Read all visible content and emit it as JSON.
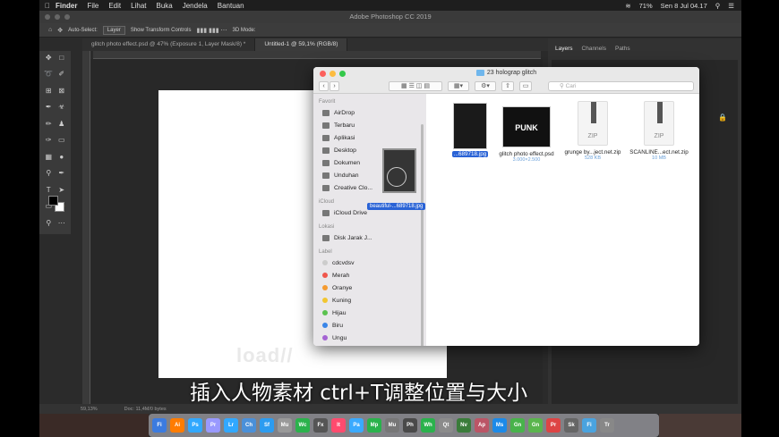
{
  "menubar": {
    "app": "Finder",
    "items": [
      "File",
      "Edit",
      "Lihat",
      "Buka",
      "Jendela",
      "Bantuan"
    ],
    "battery": "71%",
    "datetime": "Sen 8 Jul  04.17"
  },
  "photoshop": {
    "title": "Adobe Photoshop CC 2019",
    "options": {
      "auto_select": "Auto-Select:",
      "layer_select": "Layer",
      "transform": "Show Transform Controls",
      "mode3d": "3D Mode:"
    },
    "tabs": [
      "glitch photo effect.psd @ 47% (Exposure 1, Layer Mask/8) *",
      "Untitled-1 @ 59,1% (RGB/8)"
    ],
    "panel_tabs": [
      "Layers",
      "Channels",
      "Paths"
    ],
    "status_zoom": "59,13%",
    "status_doc": "Doc: 11,4M/0 bytes"
  },
  "finder": {
    "title": "23 holograp glitch",
    "search_placeholder": "Cari",
    "sidebar": {
      "favorites_label": "Favorit",
      "favorites": [
        "AirDrop",
        "Terbaru",
        "Aplikasi",
        "Desktop",
        "Dokumen",
        "Unduhan",
        "Creative Clo..."
      ],
      "icloud_label": "iCloud",
      "icloud": [
        "iCloud Drive"
      ],
      "locations_label": "Lokasi",
      "locations": [
        "Disk Jarak J..."
      ],
      "tags_label": "Label",
      "tags": [
        {
          "name": "cdcvdsv",
          "color": "#cccccc"
        },
        {
          "name": "Merah",
          "color": "#f0564c"
        },
        {
          "name": "Oranye",
          "color": "#f59a2f"
        },
        {
          "name": "Kuning",
          "color": "#f2c630"
        },
        {
          "name": "Hijau",
          "color": "#5bc24f"
        },
        {
          "name": "Biru",
          "color": "#3a86e8"
        },
        {
          "name": "Ungu",
          "color": "#a463d3"
        }
      ]
    },
    "files": [
      {
        "name": "...689718.jpg",
        "sub": ""
      },
      {
        "name": "glitch photo effect.psd",
        "sub": "3.000×2.500"
      },
      {
        "name": "grunge by...ject.net.zip",
        "sub": "528 KB"
      },
      {
        "name": "SCANLINE...ect.net.zip",
        "sub": "10 MB"
      }
    ],
    "drag_label": "beautiful-...689718.jpg",
    "zip_label": "ZIP",
    "punk_text": "PUNK"
  },
  "overlay_text": "load//",
  "subtitle": "插入人物素材 ctrl+T调整位置与大小",
  "dock_apps": [
    "Fi",
    "Ai",
    "Ps",
    "Pr",
    "Lr",
    "Ch",
    "Sf",
    "Mu",
    "Wc",
    "Fx",
    "It",
    "Pa",
    "Mp",
    "Mu",
    "Ph",
    "Wh",
    "Qt",
    "Nv",
    "Ap",
    "Ms",
    "Gn",
    "Gn",
    "Pr",
    "Sk",
    "Fi",
    "Tr"
  ]
}
